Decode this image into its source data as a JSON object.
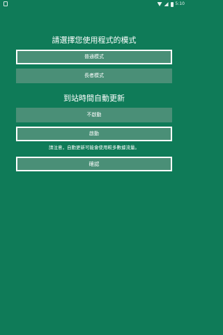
{
  "status_bar": {
    "time": "5:10",
    "icons": [
      "notification-icon",
      "wifi-icon",
      "signal-icon",
      "battery-icon"
    ]
  },
  "mode_section": {
    "title": "請選擇您使用程式的模式",
    "options": [
      {
        "label": "普通模式",
        "selected": true
      },
      {
        "label": "長者模式",
        "selected": false
      }
    ]
  },
  "auto_update_section": {
    "title": "到站時間自動更新",
    "options": [
      {
        "label": "不啟動",
        "selected": false
      },
      {
        "label": "啟動",
        "selected": true
      }
    ],
    "note": "請注意，自動更新可能會使用較多數據流量。"
  },
  "confirm_button": {
    "label": "確認"
  },
  "colors": {
    "background": "#0f7b58",
    "button": "#4a8f77",
    "text": "#ffffff"
  }
}
